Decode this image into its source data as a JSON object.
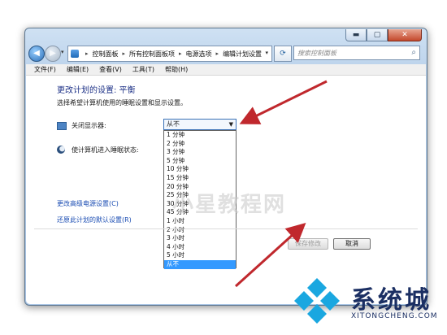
{
  "window": {
    "caption_buttons": {
      "minimize": "▬",
      "maximize": "▢",
      "close": "✕"
    }
  },
  "address_bar": {
    "breadcrumbs": [
      "控制面板",
      "所有控制面板项",
      "电源选项",
      "编辑计划设置"
    ],
    "search_placeholder": "搜索控制面板",
    "back_icon": "back-arrow-icon",
    "forward_icon": "forward-arrow-icon",
    "refresh_icon": "refresh-icon",
    "search_icon": "search-icon"
  },
  "menubar": {
    "items": [
      "文件(F)",
      "编辑(E)",
      "查看(V)",
      "工具(T)",
      "帮助(H)"
    ]
  },
  "main": {
    "title": "更改计划的设置: 平衡",
    "description": "选择希望计算机使用的睡眠设置和显示设置。",
    "display_label": "关闭显示器:",
    "sleep_label": "使计算机进入睡眠状态:",
    "display_selected": "从不",
    "dropdown_options": [
      "1 分钟",
      "2 分钟",
      "3 分钟",
      "5 分钟",
      "10 分钟",
      "15 分钟",
      "20 分钟",
      "25 分钟",
      "30 分钟",
      "45 分钟",
      "1 小时",
      "2 小时",
      "3 小时",
      "4 小时",
      "5 小时",
      "从不"
    ],
    "selected_index": 15,
    "link_advanced": "更改高级电源设置(C)",
    "link_restore": "还原此计划的默认设置(R)",
    "save_button": "保存修改",
    "cancel_button": "取消"
  },
  "watermark": "小星教程网",
  "brand": {
    "name": "系统城",
    "url": "XITONGCHENG.COM"
  },
  "colors": {
    "link": "#1b4db3",
    "title": "#1e3287",
    "selection": "#3399ff",
    "annotation_arrow": "#c0282d"
  }
}
